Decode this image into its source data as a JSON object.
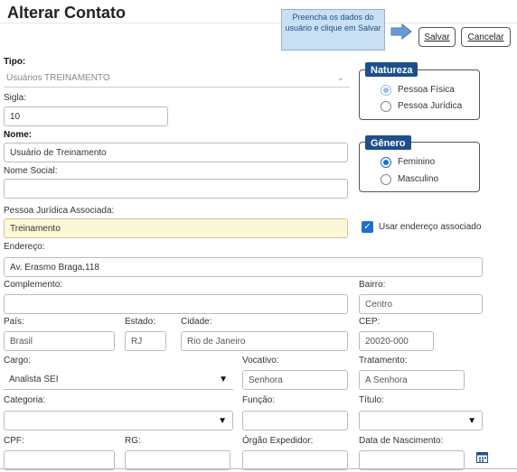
{
  "page": {
    "title": "Alterar Contato"
  },
  "tip": {
    "text": "Preencha os dados do usuário e clique em Salvar"
  },
  "buttons": {
    "save": "Salvar",
    "cancel": "Cancelar"
  },
  "tipo": {
    "label": "Tipo:",
    "value": "Usuários TREINAMENTO"
  },
  "sigla": {
    "label": "Sigla:",
    "value": "10"
  },
  "nome": {
    "label": "Nome:",
    "value": "Usuário de Treinamento"
  },
  "nome_social": {
    "label": "Nome Social:",
    "value": ""
  },
  "pj": {
    "label": "Pessoa Jurídica Associada:",
    "value": "Treinamento"
  },
  "usar_endereco": {
    "label": "Usar endereço associado",
    "checked": true
  },
  "endereco": {
    "label": "Endereço:",
    "value": "Av. Erasmo Braga,118"
  },
  "complemento": {
    "label": "Complemento:",
    "value": ""
  },
  "bairro": {
    "label": "Bairro:",
    "value": "Centro"
  },
  "pais": {
    "label": "País:",
    "value": "Brasil"
  },
  "estado": {
    "label": "Estado:",
    "value": "RJ"
  },
  "cidade": {
    "label": "Cidade:",
    "value": "Rio de Janeiro"
  },
  "cep": {
    "label": "CEP:",
    "value": "20020-000"
  },
  "cargo": {
    "label": "Cargo:",
    "value": "Analista SEI"
  },
  "vocativo": {
    "label": "Vocativo:",
    "value": "Senhora"
  },
  "tratamento": {
    "label": "Tratamento:",
    "value": "A Senhora"
  },
  "categoria": {
    "label": "Categoria:",
    "value": ""
  },
  "funcao": {
    "label": "Função:",
    "value": ""
  },
  "titulo": {
    "label": "Título:",
    "value": ""
  },
  "cpf": {
    "label": "CPF:"
  },
  "rg": {
    "label": "RG:"
  },
  "orgao": {
    "label": "Órgão Expedidor:"
  },
  "nascimento": {
    "label": "Data de Nascimento:"
  },
  "natureza": {
    "legend": "Natureza",
    "options": [
      "Pessoa Física",
      "Pessoa Jurídica"
    ],
    "selected": "Pessoa Física"
  },
  "genero": {
    "legend": "Gênero",
    "options": [
      "Feminino",
      "Masculino"
    ],
    "selected": "Feminino"
  },
  "colors": {
    "accent": "#1e4f8a",
    "radio": "#1e6fd1",
    "tip_bg": "#c9dff4",
    "yellow_field": "#fbf7d7"
  },
  "icons": {
    "arrow": "arrow-right-icon",
    "calendar": "calendar-icon",
    "chevron": "chevron-down-icon"
  }
}
